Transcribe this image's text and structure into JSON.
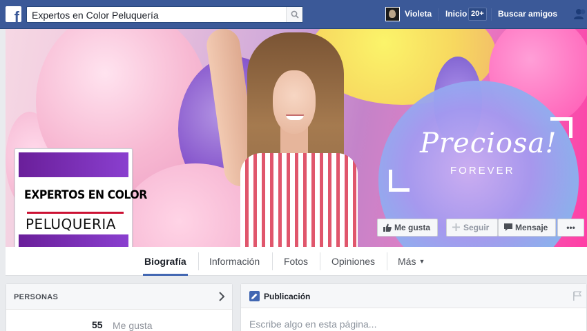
{
  "topbar": {
    "logo_glyph": "f",
    "search_value": "Expertos en Color Peluquería",
    "user_name": "Violeta",
    "home_label": "Inicio",
    "home_badge": "20+",
    "find_friends_label": "Buscar amigos",
    "icons": [
      "facebook-logo-icon",
      "search-icon",
      "friends-icon"
    ]
  },
  "cover": {
    "tagline": "Preciosa!",
    "tagline_sub": "FOREVER",
    "buttons": {
      "like": "Me gusta",
      "follow": "Seguir",
      "message": "Mensaje",
      "more": "•••"
    }
  },
  "profile_picture": {
    "line1": "EXPERTOS EN COLOR",
    "line2": "PELUQUERIA",
    "colors": {
      "band": "#7a2fb8",
      "rule": "#cc1133"
    }
  },
  "tabs": [
    {
      "label": "Biografía",
      "active": true
    },
    {
      "label": "Información",
      "active": false
    },
    {
      "label": "Fotos",
      "active": false
    },
    {
      "label": "Opiniones",
      "active": false
    },
    {
      "label": "Más",
      "active": false
    }
  ],
  "people_box": {
    "title": "PERSONAS",
    "likes_count": "55",
    "likes_label": "Me gusta"
  },
  "composer": {
    "title": "Publicación",
    "placeholder": "Escribe algo en esta página..."
  },
  "colors": {
    "brand_blue": "#3b5998",
    "tab_active": "#4267b2",
    "page_bg": "#e9ebee"
  }
}
